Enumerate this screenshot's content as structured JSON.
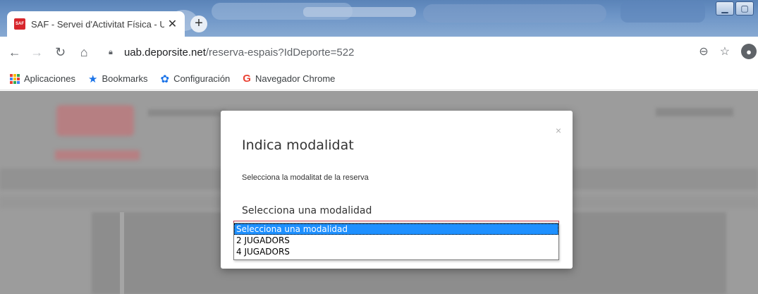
{
  "browser": {
    "tab_title": "SAF - Servei d'Activitat Física - Ur",
    "favicon_text": "SAF",
    "url_host": "uab.deporsite.net",
    "url_path": "/reserva-espais?IdDeporte=522"
  },
  "bookmarks": [
    {
      "label": "Aplicaciones",
      "icon": "apps-icon"
    },
    {
      "label": "Bookmarks",
      "icon": "star-icon"
    },
    {
      "label": "Configuración",
      "icon": "gear-icon"
    },
    {
      "label": "Navegador Chrome",
      "icon": "google-icon"
    }
  ],
  "modal": {
    "title": "Indica modalidat",
    "close_glyph": "×",
    "subtitle": "Selecciona la modalitat de la reserva",
    "field_label": "Selecciona una modalidad",
    "options": [
      "Selecciona una modalidad",
      "2 JUGADORS",
      "4 JUGADORS"
    ],
    "selected_index": 0
  }
}
